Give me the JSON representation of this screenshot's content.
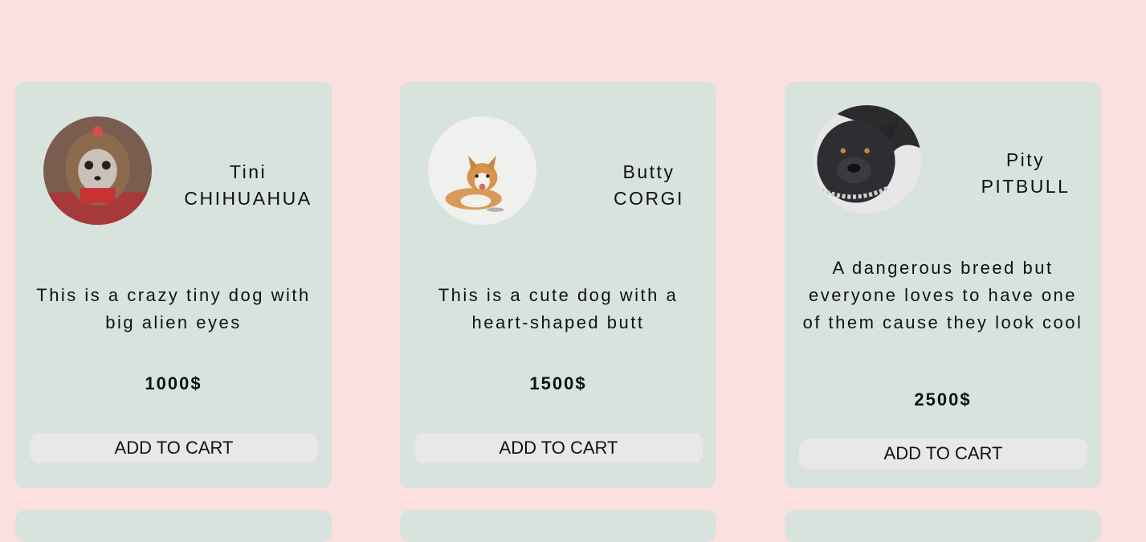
{
  "products": [
    {
      "name": "Tini",
      "breed": "CHIHUAHUA",
      "description": "This is a crazy tiny dog with big alien eyes",
      "price": "1000$",
      "button_label": "ADD TO CART",
      "image_icon": "chihuahua-photo"
    },
    {
      "name": "Butty",
      "breed": "CORGI",
      "description": "This is a cute dog with a heart-shaped butt",
      "price": "1500$",
      "button_label": "ADD TO CART",
      "image_icon": "corgi-photo"
    },
    {
      "name": "Pity",
      "breed": "PITBULL",
      "description": "A dangerous breed but everyone loves to have one of them cause they look cool",
      "price": "2500$",
      "button_label": "ADD TO CART",
      "image_icon": "pitbull-photo"
    }
  ],
  "colors": {
    "page_background": "#fce0df",
    "card_background": "#d8e3de",
    "button_background": "#e8e8e6"
  }
}
